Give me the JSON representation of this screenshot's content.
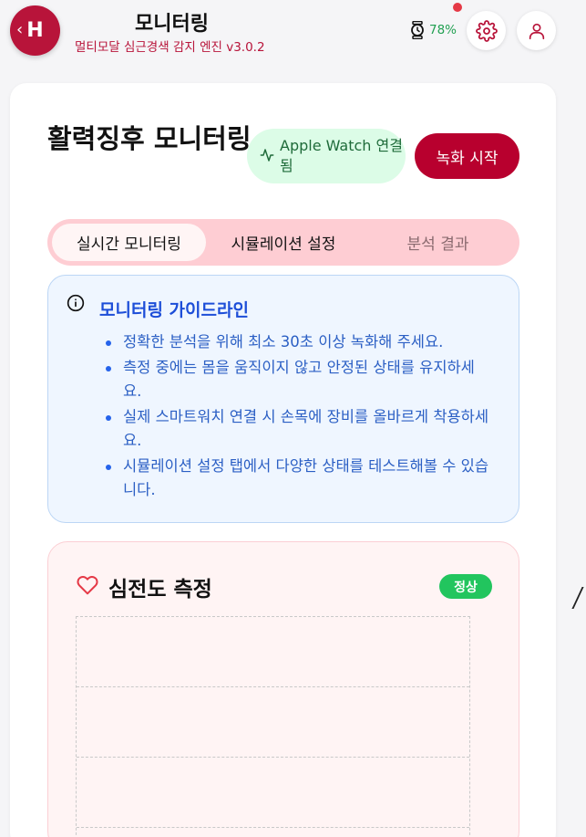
{
  "header": {
    "logo_letter": "H",
    "title": "모니터링",
    "subtitle": "멀티모달 심근경색 감지 엔진 v3.0.2",
    "battery": "78%",
    "accent_color": "#b8143a",
    "icons": [
      "watch-icon",
      "gear-icon",
      "user-icon"
    ]
  },
  "main": {
    "section_title": "활력징후 모니터링",
    "connection_badge": "Apple Watch 연결됨",
    "record_button": "녹화 시작",
    "tabs": [
      {
        "label": "실시간 모니터링",
        "active": true
      },
      {
        "label": "시뮬레이션 설정",
        "active": false
      },
      {
        "label": "분석 결과",
        "active": false
      }
    ]
  },
  "guide": {
    "title": "모니터링 가이드라인",
    "items": [
      "정확한 분석을 위해 최소 30초 이상 녹화해 주세요.",
      "측정 중에는 몸을 움직이지 않고 안정된 상태를 유지하세요.",
      "실제 스마트워치 연결 시 손목에 장비를 올바르게 착용하세요.",
      "시뮬레이션 설정 탭에서 다양한 상태를 테스트해볼 수 있습니다."
    ]
  },
  "ecg": {
    "title": "심전도 측정",
    "status": "정상",
    "status_color": "#22c55e"
  }
}
